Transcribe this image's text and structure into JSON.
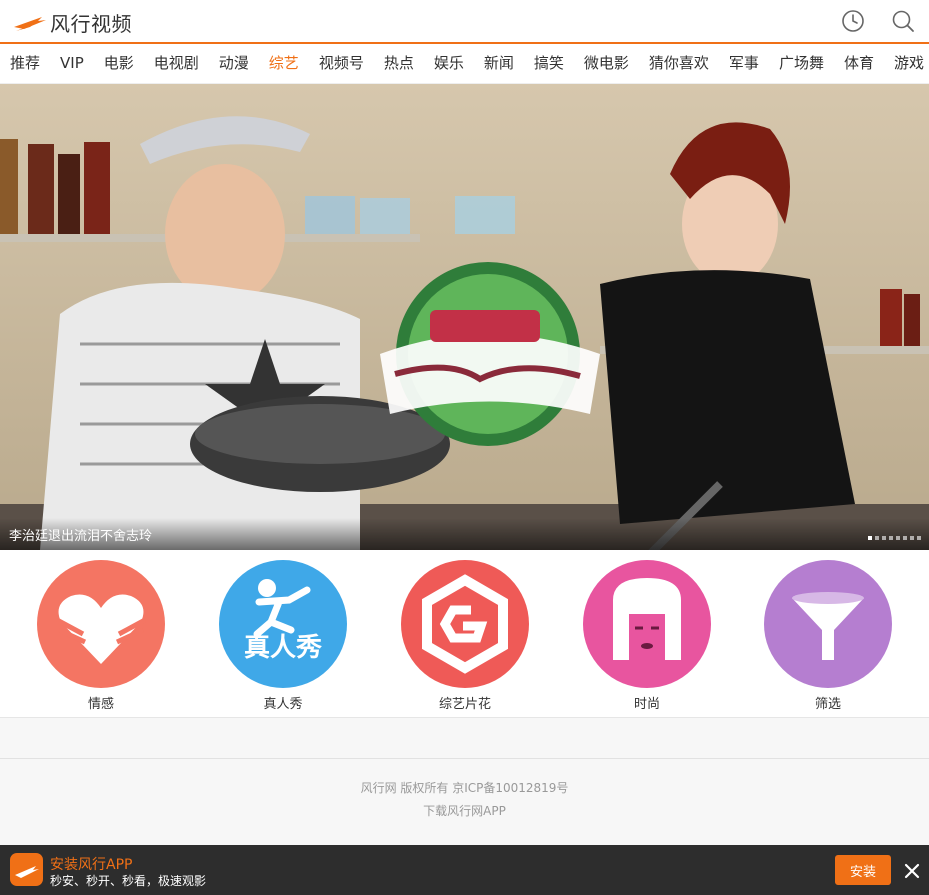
{
  "header": {
    "logo_text": "风行视频",
    "history_icon": "clock-icon",
    "search_icon": "search-icon"
  },
  "nav": {
    "items": [
      "推荐",
      "VIP",
      "电影",
      "电视剧",
      "动漫",
      "综艺",
      "视频号",
      "热点",
      "娱乐",
      "新闻",
      "搞笑",
      "微电影",
      "猜你喜欢",
      "军事",
      "广场舞",
      "体育",
      "游戏"
    ],
    "active": "综艺"
  },
  "banner": {
    "caption": "李治廷退出流泪不舍志玲",
    "slide_count": 8,
    "active_slide": 1
  },
  "categories": [
    {
      "label": "情感",
      "color": "#f47563",
      "icon": "heart-hands-icon"
    },
    {
      "label": "真人秀",
      "color": "#3fa8e8",
      "icon": "running-man-icon"
    },
    {
      "label": "综艺片花",
      "color": "#ef5a57",
      "icon": "hexagon-g-icon"
    },
    {
      "label": "时尚",
      "color": "#e8559f",
      "icon": "woman-face-icon"
    },
    {
      "label": "筛选",
      "color": "#b57ed0",
      "icon": "funnel-icon"
    }
  ],
  "footer": {
    "copyright": "风行网 版权所有 京ICP备10012819号",
    "download": "下载风行网APP"
  },
  "appbar": {
    "title": "安装风行APP",
    "subtitle": "秒安、秒开、秒看，极速观影",
    "install_label": "安装",
    "close_icon": "close-icon"
  },
  "colors": {
    "brand": "#f07016"
  }
}
